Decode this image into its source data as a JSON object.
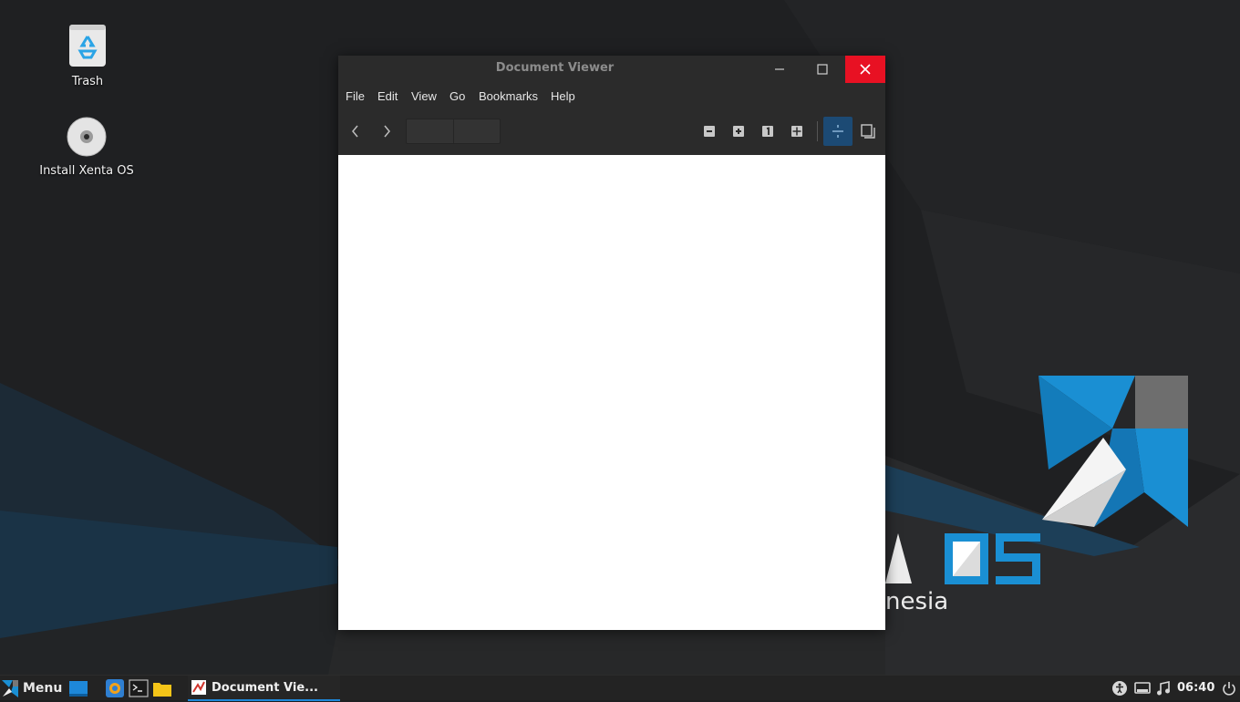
{
  "desktop": {
    "icons": [
      {
        "label": "Trash"
      },
      {
        "label": "Install Xenta OS"
      }
    ],
    "wallpaper_text": {
      "logo": "A OS",
      "subtitle": "nesia"
    }
  },
  "window": {
    "title": "Document Viewer",
    "menu": [
      "File",
      "Edit",
      "View",
      "Go",
      "Bookmarks",
      "Help"
    ]
  },
  "panel": {
    "menu_label": "Menu",
    "task_label": "Document Vie...",
    "clock": "06:40"
  },
  "colors": {
    "accent": "#1e88d9",
    "close_button": "#e81123",
    "logo_blue": "#1a8fd3"
  }
}
